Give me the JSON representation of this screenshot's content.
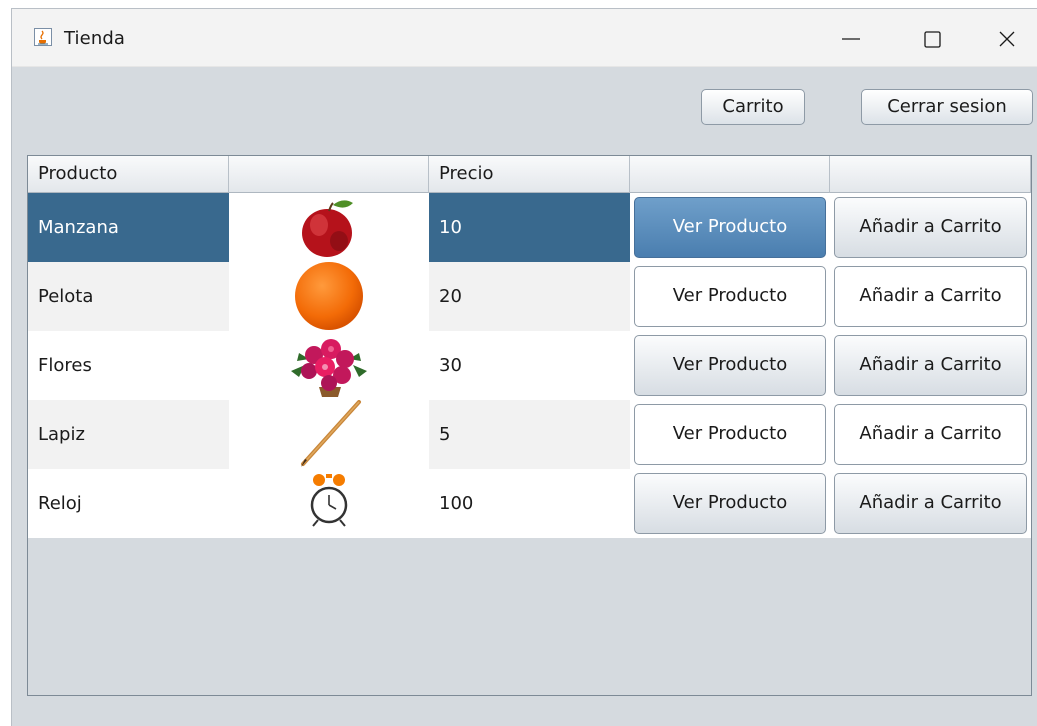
{
  "window": {
    "title": "Tienda",
    "icon": "java-cup-icon",
    "controls": [
      "minimize-icon",
      "maximize-icon",
      "close-icon"
    ]
  },
  "toolbar": {
    "carrito_label": "Carrito",
    "cerrar_sesion_label": "Cerrar sesion"
  },
  "table": {
    "columns": [
      "Producto",
      "",
      "Precio",
      "",
      ""
    ],
    "selected_row": 0,
    "rows": [
      {
        "producto": "Manzana",
        "image": "apple-icon",
        "precio": "10",
        "ver": "Ver Producto",
        "anadir": "Añadir a Carrito"
      },
      {
        "producto": "Pelota",
        "image": "orange-ball-icon",
        "precio": "20",
        "ver": "Ver Producto",
        "anadir": "Añadir a Carrito"
      },
      {
        "producto": "Flores",
        "image": "flowers-icon",
        "precio": "30",
        "ver": "Ver Producto",
        "anadir": "Añadir a Carrito"
      },
      {
        "producto": "Lapiz",
        "image": "pencil-icon",
        "precio": "5",
        "ver": "Ver Producto",
        "anadir": "Añadir a Carrito"
      },
      {
        "producto": "Reloj",
        "image": "alarm-clock-icon",
        "precio": "100",
        "ver": "Ver Producto",
        "anadir": "Añadir a Carrito"
      }
    ]
  },
  "colors": {
    "window_bg": "#d5dadf",
    "selection": "#39698e",
    "active_button": "#5a8cbc"
  }
}
